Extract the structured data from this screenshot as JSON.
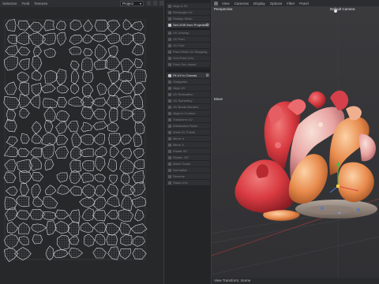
{
  "uv_editor": {
    "menu": [
      "Selection",
      "Field",
      "Textures"
    ],
    "channel_select": "Project"
  },
  "tools": [
    {
      "label": "Align & Fit",
      "active": false
    },
    {
      "label": "Rectangle UV",
      "active": false
    },
    {
      "label": "Realign Mesh",
      "active": false
    },
    {
      "label": "Set UVW from Projection",
      "active": true,
      "gear": true
    },
    {
      "label": "UV Unwrap",
      "active": false
    },
    {
      "label": "UV Peel",
      "active": false
    },
    {
      "label": "UV Fold",
      "active": false
    },
    {
      "label": "Pack Relax UV Mapping",
      "active": false
    },
    {
      "label": "Grid Pack UVs",
      "active": false
    },
    {
      "label": "Pack Geo Island",
      "active": false
    },
    {
      "label": "Fit UV to Canvas",
      "active": true,
      "gear": true
    },
    {
      "label": "Straighten",
      "active": false
    },
    {
      "label": "Align UV",
      "active": false
    },
    {
      "label": "UV Relaxation",
      "active": false
    },
    {
      "label": "UV Symmetry",
      "active": false
    },
    {
      "label": "UV Break Borders",
      "active": false
    },
    {
      "label": "Align to Contour",
      "active": false
    },
    {
      "label": "Transform UV",
      "active": false
    },
    {
      "label": "Distribution Relax",
      "active": false
    },
    {
      "label": "Weld UV Points",
      "active": false
    },
    {
      "label": "Mirror U",
      "active": false
    },
    {
      "label": "Mirror V",
      "active": false
    },
    {
      "label": "Rotate 90°",
      "active": false
    },
    {
      "label": "Rotate -90°",
      "active": false
    },
    {
      "label": "Match Scale",
      "active": false
    },
    {
      "label": "Normalize",
      "active": false
    },
    {
      "label": "Reverse",
      "active": false
    },
    {
      "label": "Stack UVs",
      "active": false
    }
  ],
  "viewport": {
    "menu": [
      "View",
      "Cameras",
      "Display",
      "Options",
      "Filter",
      "Panel"
    ],
    "view_name": "Perspective",
    "camera_name": "Default Camera",
    "move_label": "Move",
    "status": "View Transform: Scene"
  },
  "colors": {
    "coral_red": "#d83a40",
    "coral_pink": "#e8a2a0",
    "coral_orange": "#e88a4c",
    "base_stone": "#8d7f76",
    "active_tool": "#dfe1e4"
  }
}
